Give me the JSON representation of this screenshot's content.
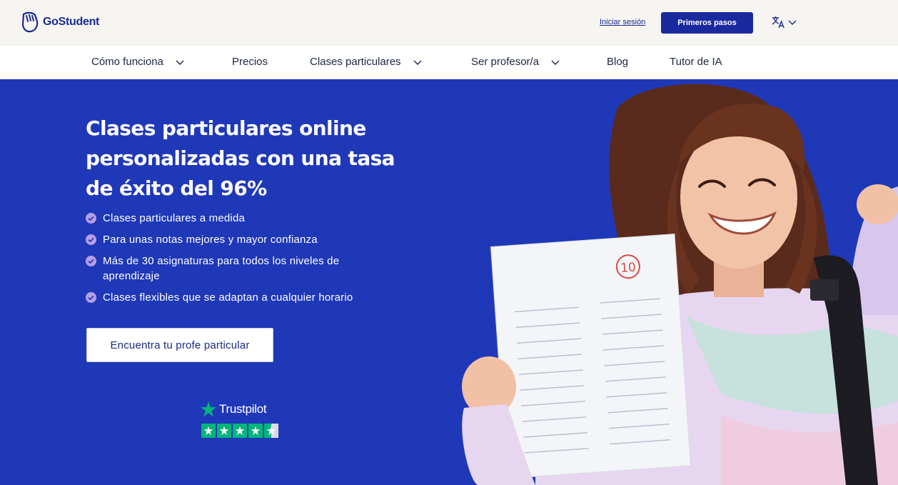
{
  "brand": {
    "name": "GoStudent",
    "color": "#1a2a9e"
  },
  "header": {
    "login_label": "Iniciar sesión",
    "cta_label": "Primeros pasos",
    "language_icon": "translate-icon"
  },
  "nav": {
    "items": [
      {
        "label": "Cómo funciona",
        "has_dropdown": true
      },
      {
        "label": "Precios",
        "has_dropdown": false
      },
      {
        "label": "Clases particulares",
        "has_dropdown": true
      },
      {
        "label": "Ser profesor/a",
        "has_dropdown": true
      },
      {
        "label": "Blog",
        "has_dropdown": false
      },
      {
        "label": "Tutor de IA",
        "has_dropdown": false
      }
    ]
  },
  "hero": {
    "title": "Clases particulares online personalizadas con una tasa de éxito del 96%",
    "benefits": [
      "Clases particulares a medida",
      "Para unas notas mejores y mayor confianza",
      "Más de 30 asignaturas para todos los niveles de aprendizaje",
      "Clases flexibles que se adaptan a cualquier horario"
    ],
    "cta_label": "Encuentra tu profe particular",
    "background": "#1f38b8",
    "check_color": "#b79ee8"
  },
  "trustpilot": {
    "name": "Trustpilot",
    "rating_stars": 4.5,
    "star_color": "#00b67a"
  },
  "photo": {
    "grade_mark": "10"
  }
}
